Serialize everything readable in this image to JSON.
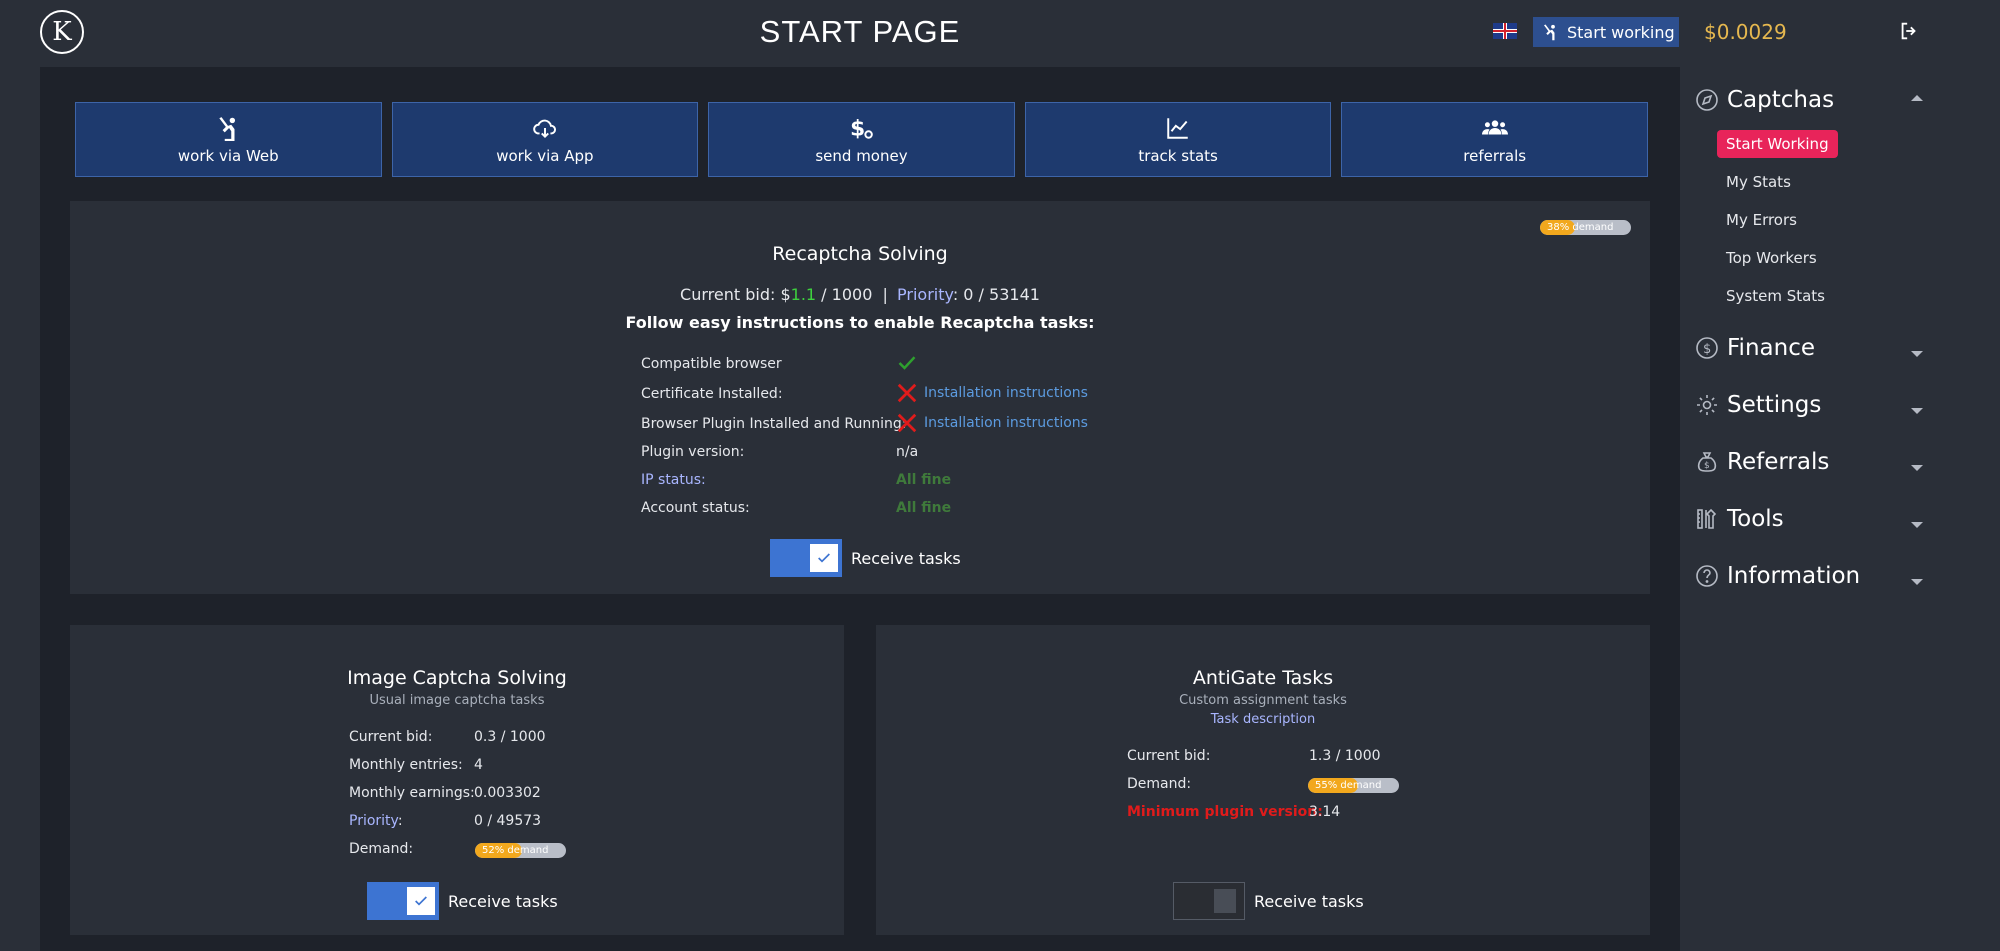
{
  "header": {
    "logo_text": "K",
    "title": "START PAGE",
    "start_working_label": "Start working",
    "balance": "$0.0029"
  },
  "tiles": [
    {
      "label": "work via Web",
      "icon": "worker-icon"
    },
    {
      "label": "work via App",
      "icon": "cloud-download-icon"
    },
    {
      "label": "send money",
      "icon": "dollar-icon"
    },
    {
      "label": "track stats",
      "icon": "chart-icon"
    },
    {
      "label": "referrals",
      "icon": "people-icon"
    }
  ],
  "recaptcha": {
    "title": "Recaptcha Solving",
    "demand_label": "38% demand",
    "demand_value": 38,
    "bid_prefix": "Current bid: $",
    "bid_value": "1.1",
    "bid_suffix": " / 1000  |",
    "priority_label": "Priority",
    "priority_value": ": 0 / 53141",
    "instructions": "Follow easy instructions to enable Recaptcha tasks:",
    "rows": [
      {
        "label": "Compatible browser",
        "value": ""
      },
      {
        "label": "Certificate Installed:",
        "value": "Installation instructions"
      },
      {
        "label": "Browser Plugin Installed and Running:",
        "value": "Installation instructions"
      },
      {
        "label": "Plugin version:",
        "value": "n/a"
      },
      {
        "label": "IP status:",
        "value": "All fine"
      },
      {
        "label": "Account status:",
        "value": "All fine"
      }
    ],
    "receive_label": "Receive tasks",
    "receive_on": true
  },
  "image_captcha": {
    "title": "Image Captcha Solving",
    "subtitle": "Usual image captcha tasks",
    "rows": [
      {
        "label": "Current bid:",
        "value": "0.3 / 1000"
      },
      {
        "label": "Monthly entries:",
        "value": "4"
      },
      {
        "label": "Monthly earnings:",
        "value": "0.003302"
      },
      {
        "label": "Priority",
        "label_suffix": ":",
        "value": "0 / 49573"
      },
      {
        "label": "Demand:",
        "value": ""
      }
    ],
    "demand_label": "52% demand",
    "demand_value": 52,
    "receive_label": "Receive tasks",
    "receive_on": true
  },
  "antigate": {
    "title": "AntiGate Tasks",
    "subtitle": "Custom assignment tasks",
    "link": "Task description",
    "rows": [
      {
        "label": "Current bid:",
        "value": "1.3 / 1000"
      },
      {
        "label": "Demand:",
        "value": ""
      },
      {
        "label": "Minimum plugin version:",
        "value": "3.14"
      }
    ],
    "demand_label": "55% demand",
    "demand_value": 55,
    "receive_label": "Receive tasks",
    "receive_on": false
  },
  "sidebar": {
    "sections": [
      {
        "label": "Captchas",
        "icon": "compass-icon",
        "expanded": true
      },
      {
        "label": "Finance",
        "icon": "dollar-circle-icon",
        "expanded": false
      },
      {
        "label": "Settings",
        "icon": "gear-icon",
        "expanded": false
      },
      {
        "label": "Referrals",
        "icon": "money-bag-icon",
        "expanded": false
      },
      {
        "label": "Tools",
        "icon": "tools-icon",
        "expanded": false
      },
      {
        "label": "Information",
        "icon": "question-icon",
        "expanded": false
      }
    ],
    "captcha_items": [
      "Start Working",
      "My Stats",
      "My Errors",
      "Top Workers",
      "System Stats"
    ]
  },
  "colors": {
    "accent": "#e8245a",
    "tile_bg": "#1e3a6e",
    "toggle_on": "#3d74d2",
    "balance": "#e6b84f",
    "demand_fill": "#f2a81d"
  }
}
